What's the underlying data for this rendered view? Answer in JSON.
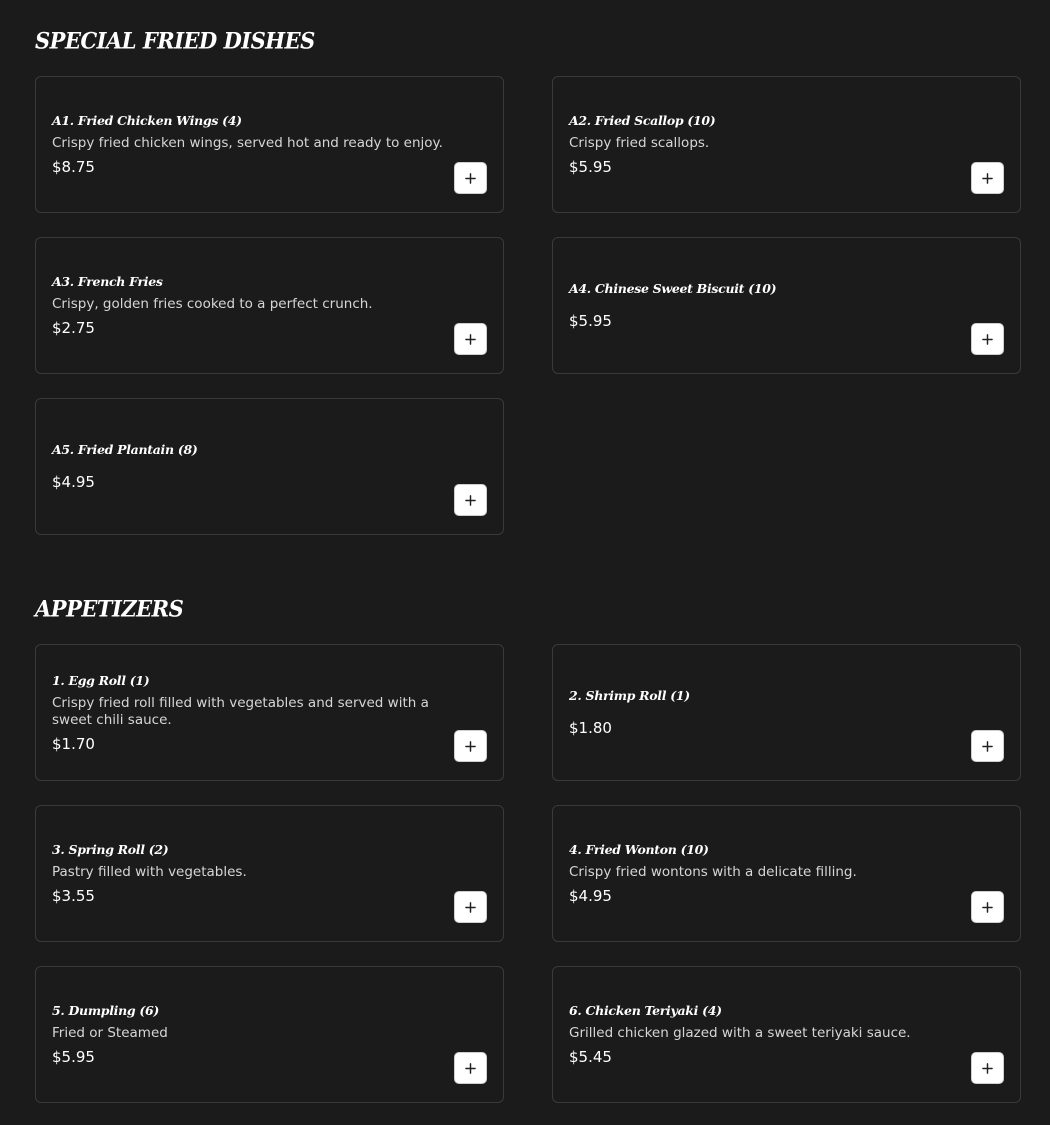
{
  "sections": [
    {
      "title": "SPECIAL FRIED DISHES",
      "items": [
        {
          "name": "A1. Fried Chicken Wings (4)",
          "desc": "Crispy fried chicken wings, served hot and ready to enjoy.",
          "price": "$8.75"
        },
        {
          "name": "A2. Fried Scallop (10)",
          "desc": "Crispy fried scallops.",
          "price": "$5.95"
        },
        {
          "name": "A3. French Fries",
          "desc": "Crispy, golden fries cooked to a perfect crunch.",
          "price": "$2.75"
        },
        {
          "name": "A4. Chinese Sweet Biscuit (10)",
          "desc": "",
          "price": "$5.95"
        },
        {
          "name": "A5. Fried Plantain (8)",
          "desc": "",
          "price": "$4.95"
        }
      ]
    },
    {
      "title": "APPETIZERS",
      "items": [
        {
          "name": "1. Egg Roll (1)",
          "desc": "Crispy fried roll filled with vegetables and served with a sweet chili sauce.",
          "price": "$1.70"
        },
        {
          "name": "2. Shrimp Roll (1)",
          "desc": "",
          "price": "$1.80"
        },
        {
          "name": "3. Spring Roll (2)",
          "desc": "Pastry filled with vegetables.",
          "price": "$3.55"
        },
        {
          "name": "4. Fried Wonton (10)",
          "desc": "Crispy fried wontons with a delicate filling.",
          "price": "$4.95"
        },
        {
          "name": "5. Dumpling (6)",
          "desc": "Fried or Steamed",
          "price": "$5.95"
        },
        {
          "name": "6. Chicken Teriyaki (4)",
          "desc": "Grilled chicken glazed with a sweet teriyaki sauce.",
          "price": "$5.45"
        }
      ]
    }
  ],
  "icons": {
    "add": "plus-icon"
  },
  "colors": {
    "background": "#1b1b1b",
    "card_border": "#3a3a3a",
    "button": "#ffffff"
  }
}
